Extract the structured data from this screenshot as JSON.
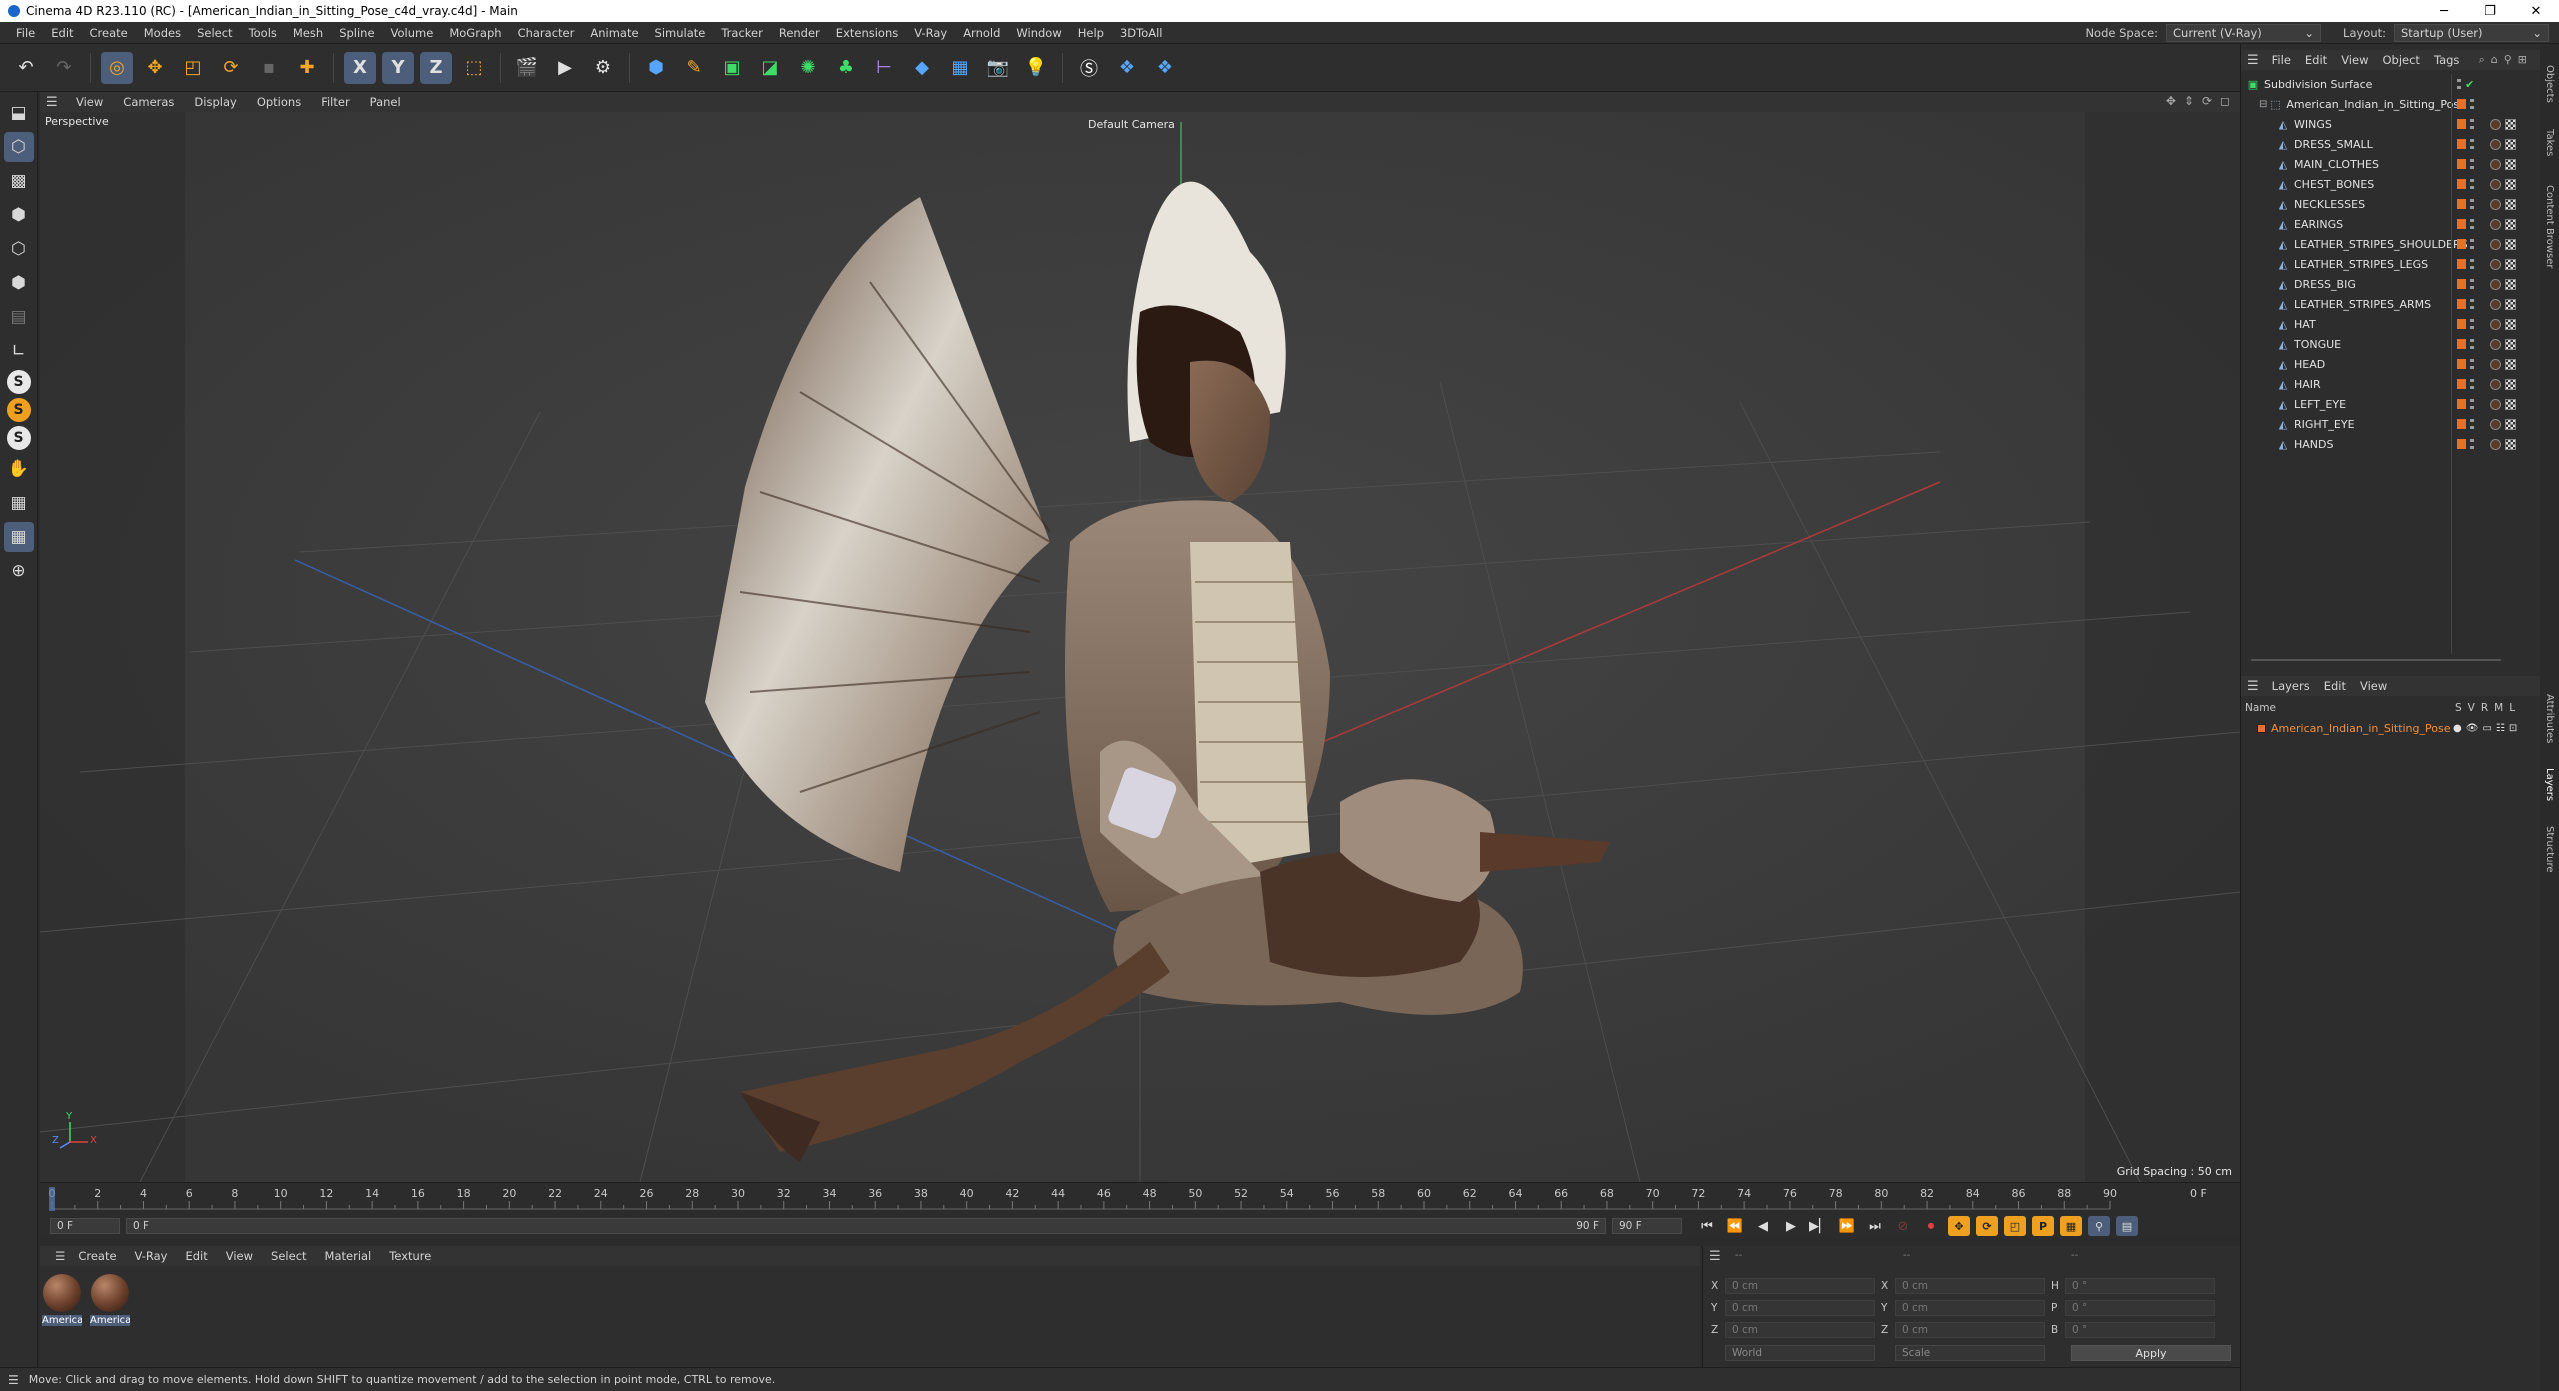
{
  "window": {
    "title": "Cinema 4D R23.110 (RC) - [American_Indian_in_Sitting_Pose_c4d_vray.c4d] - Main",
    "controls": [
      "─",
      "❐",
      "✕"
    ]
  },
  "menubar": {
    "items": [
      "File",
      "Edit",
      "Create",
      "Modes",
      "Select",
      "Tools",
      "Mesh",
      "Spline",
      "Volume",
      "MoGraph",
      "Character",
      "Animate",
      "Simulate",
      "Tracker",
      "Render",
      "Extensions",
      "V-Ray",
      "Arnold",
      "Window",
      "Help",
      "3DToAll"
    ],
    "node_space_label": "Node Space:",
    "node_space_value": "Current (V-Ray)",
    "layout_label": "Layout:",
    "layout_value": "Startup (User)"
  },
  "toolbar": {
    "axis_x": "X",
    "axis_y": "Y",
    "axis_z": "Z"
  },
  "viewport": {
    "menu": [
      "View",
      "Cameras",
      "Display",
      "Options",
      "Filter",
      "Panel"
    ],
    "view_name": "Perspective",
    "camera": "Default Camera",
    "grid_spacing": "Grid Spacing : 50 cm",
    "axis_y": "Y",
    "axis_z": "Z",
    "axis_x": "X"
  },
  "timeline": {
    "ticks": [
      "0",
      "2",
      "4",
      "6",
      "8",
      "10",
      "12",
      "14",
      "16",
      "18",
      "20",
      "22",
      "24",
      "26",
      "28",
      "30",
      "32",
      "34",
      "36",
      "38",
      "40",
      "42",
      "44",
      "46",
      "48",
      "50",
      "52",
      "54",
      "56",
      "58",
      "60",
      "62",
      "64",
      "66",
      "68",
      "70",
      "72",
      "74",
      "76",
      "78",
      "80",
      "82",
      "84",
      "86",
      "88",
      "90"
    ],
    "current_frame_label": "0 F",
    "start_frame": "0 F",
    "range_start": "0 F",
    "range_end": "90 F",
    "end_frame": "90 F"
  },
  "material_manager": {
    "menu": [
      "Create",
      "V-Ray",
      "Edit",
      "View",
      "Select",
      "Material",
      "Texture"
    ],
    "materials": [
      "America",
      "America"
    ]
  },
  "coordinates": {
    "header_dashes": [
      "--",
      "--",
      "--"
    ],
    "rows": [
      {
        "axis": "X",
        "pos": "0 cm",
        "size_axis": "X",
        "size": "0 cm",
        "rot_axis": "H",
        "rot": "0 °"
      },
      {
        "axis": "Y",
        "pos": "0 cm",
        "size_axis": "Y",
        "size": "0 cm",
        "rot_axis": "P",
        "rot": "0 °"
      },
      {
        "axis": "Z",
        "pos": "0 cm",
        "size_axis": "Z",
        "size": "0 cm",
        "rot_axis": "B",
        "rot": "0 °"
      }
    ],
    "mode_world": "World",
    "mode_scale": "Scale",
    "apply": "Apply"
  },
  "status": "Move: Click and drag to move elements. Hold down SHIFT to quantize movement / add to the selection in point mode, CTRL to remove.",
  "object_manager": {
    "menu": [
      "File",
      "Edit",
      "View",
      "Object",
      "Tags"
    ],
    "root": "Subdivision Surface",
    "parent": "American_Indian_in_Sitting_Pose",
    "children": [
      "WINGS",
      "DRESS_SMALL",
      "MAIN_CLOTHES",
      "CHEST_BONES",
      "NECKLESSES",
      "EARINGS",
      "LEATHER_STRIPES_SHOULDERS",
      "LEATHER_STRIPES_LEGS",
      "DRESS_BIG",
      "LEATHER_STRIPES_ARMS",
      "HAT",
      "TONGUE",
      "HEAD",
      "HAIR",
      "LEFT_EYE",
      "RIGHT_EYE",
      "HANDS"
    ]
  },
  "layers_manager": {
    "menu": [
      "Layers",
      "Edit",
      "View"
    ],
    "col_name": "Name",
    "col_flags": [
      "S",
      "V",
      "R",
      "M",
      "L"
    ],
    "layer": "American_Indian_in_Sitting_Pose",
    "layer_color": "#e8702a"
  },
  "side_tabs": [
    "Objects",
    "Takes",
    "Content Browser",
    "Attributes",
    "Layers",
    "Structure"
  ]
}
